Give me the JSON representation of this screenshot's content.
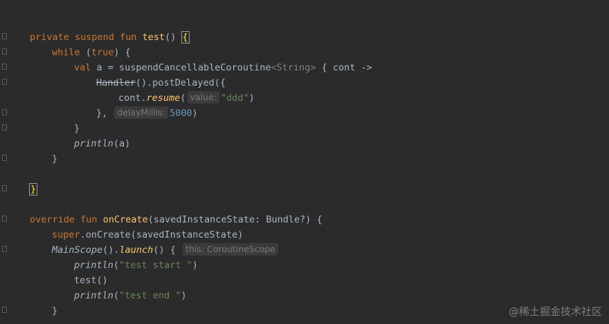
{
  "code": {
    "l1": {
      "kw1": "private",
      "kw2": "suspend",
      "kw3": "fun",
      "name": "test",
      "paren": "()",
      "brace": "{"
    },
    "l2": {
      "kw": "while",
      "open": " (",
      "val": "true",
      "close": ") {"
    },
    "l3": {
      "kw": "val",
      "mid": " a = suspendCancellableCoroutine",
      "generic": "<String>",
      "tail": " { cont ->"
    },
    "l4": {
      "cls": "Handler",
      "tail": "().postDelayed({"
    },
    "l5": {
      "pre": "cont.",
      "fn": "resume",
      "open": "(",
      "hint": "value:",
      "str": "\"ddd\"",
      "close": ")"
    },
    "l6": {
      "pre": "},",
      "hint": "delayMillis:",
      "num": "5000",
      "close": ")"
    },
    "l7": {
      "text": "}"
    },
    "l8": {
      "fn": "println",
      "args": "(a)"
    },
    "l9": {
      "text": "}"
    },
    "l11": {
      "text": "}"
    },
    "l13": {
      "kw1": "override",
      "kw2": "fun",
      "name": "onCreate",
      "args": "(savedInstanceState: Bundle?) {"
    },
    "l14": {
      "kw": "super",
      "tail": ".onCreate(savedInstanceState)"
    },
    "l15": {
      "cls": "MainScope",
      "mid": "().",
      "fn": "launch",
      "paren": "()",
      "brace": " {",
      "hint": "this: CoroutineScope"
    },
    "l16": {
      "fn": "println",
      "open": "(",
      "str": "\"test start \"",
      "close": ")"
    },
    "l17": {
      "text": "test()"
    },
    "l18": {
      "fn": "println",
      "open": "(",
      "str": "\"test end \"",
      "close": ")"
    },
    "l19": {
      "text": "}"
    }
  },
  "watermark": "@稀土掘金技术社区",
  "colors": {
    "background": "#2b2b2b",
    "keyword": "#cc7832",
    "function": "#ffc66d",
    "string": "#6a8759",
    "number": "#6897bb",
    "text": "#a9b7c6"
  }
}
